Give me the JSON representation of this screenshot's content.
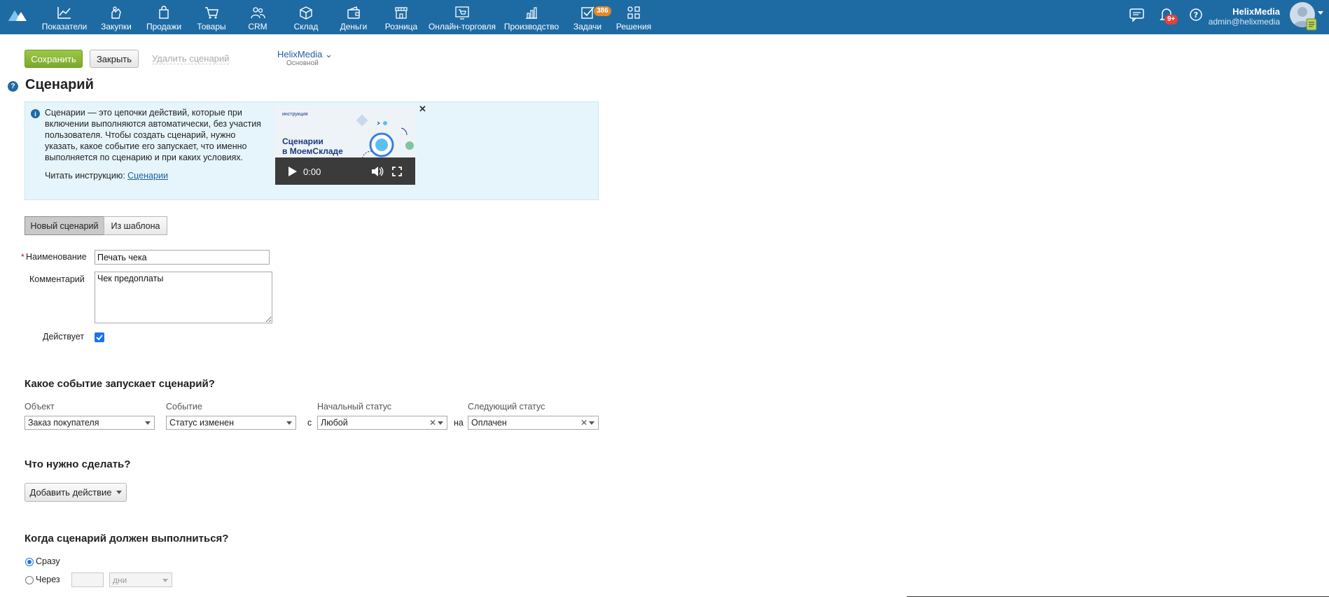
{
  "nav": {
    "items": [
      {
        "label": "Показатели",
        "icon": "chart-line-icon"
      },
      {
        "label": "Закупки",
        "icon": "purchase-hand-icon"
      },
      {
        "label": "Продажи",
        "icon": "shopping-bag-icon"
      },
      {
        "label": "Товары",
        "icon": "cart-icon"
      },
      {
        "label": "CRM",
        "icon": "people-icon"
      },
      {
        "label": "Склад",
        "icon": "box-icon"
      },
      {
        "label": "Деньги",
        "icon": "wallet-icon"
      },
      {
        "label": "Розница",
        "icon": "store-icon"
      },
      {
        "label": "Онлайн-торговля",
        "icon": "online-store-icon"
      },
      {
        "label": "Производство",
        "icon": "bar-chart-icon"
      },
      {
        "label": "Задачи",
        "icon": "tasks-check-icon"
      },
      {
        "label": "Решения",
        "icon": "apps-grid-icon"
      }
    ],
    "tasks_badge": "386",
    "notifications_badge": "9+",
    "user_name": "HelixMedia",
    "user_email": "admin@helixmedia"
  },
  "toolbar": {
    "save_label": "Сохранить",
    "close_label": "Закрыть",
    "delete_label": "Удалить сценарий",
    "org_name": "HelixMedia",
    "org_sub": "Основной"
  },
  "page": {
    "title": "Сценарий"
  },
  "info": {
    "text": "Сценарии — это цепочки действий, которые при включении выполняются автоматически, без участия пользователя. Чтобы создать сценарий, нужно указать, какое событие его запускает, что именно выполняется по сценарию и при каких условиях.",
    "read_prefix": "Читать инструкцию:",
    "read_link": "Сценарии",
    "video": {
      "tag": "инструкция",
      "title_line1": "Сценарии",
      "title_line2": "в МоемСкладе",
      "time": "0:00"
    }
  },
  "tabs": [
    {
      "label": "Новый сценарий",
      "active": true
    },
    {
      "label": "Из шаблона",
      "active": false
    }
  ],
  "form": {
    "name_label": "Наименование",
    "name_value": "Печать чека",
    "comment_label": "Комментарий",
    "comment_value": "Чек предоплаты",
    "active_label": "Действует",
    "active_checked": true
  },
  "trigger": {
    "heading": "Какое событие запускает сценарий?",
    "object_label": "Объект",
    "object_value": "Заказ покупателя",
    "event_label": "Событие",
    "event_value": "Статус изменен",
    "from_conj": "с",
    "start_status_label": "Начальный статус",
    "start_status_value": "Любой",
    "to_conj": "на",
    "next_status_label": "Следующий статус",
    "next_status_value": "Оплачен"
  },
  "action": {
    "heading": "Что нужно сделать?",
    "add_label": "Добавить действие"
  },
  "timing": {
    "heading": "Когда сценарий должен выполниться?",
    "now_label": "Сразу",
    "now_selected": true,
    "after_label": "Через",
    "unit_value": "дни"
  },
  "colors": {
    "topbar": "#1e6ba4",
    "save": "#8bb838",
    "link": "#1b5f9c",
    "info_bg": "#e6f5fc",
    "badge_orange": "#e08a2b",
    "badge_red": "#e5403a"
  }
}
